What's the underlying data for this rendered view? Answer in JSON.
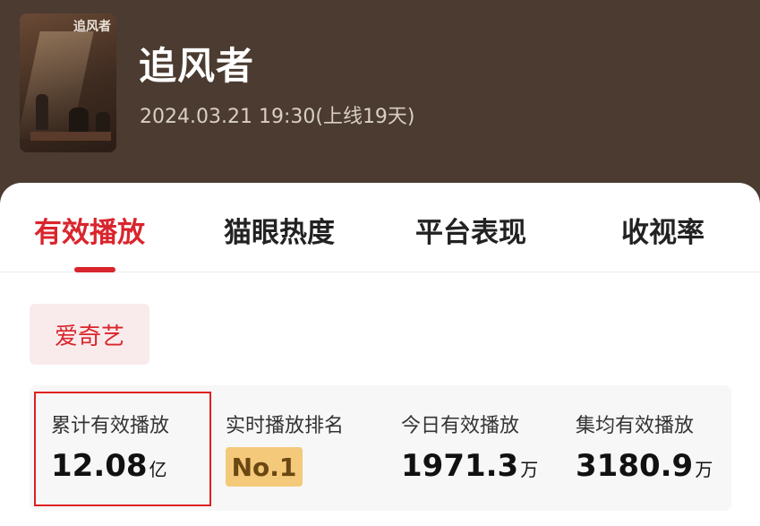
{
  "show": {
    "poster_title": "追风者",
    "title": "追风者",
    "subtitle": "2024.03.21 19:30(上线19天)"
  },
  "tabs": [
    {
      "label": "有效播放",
      "active": true
    },
    {
      "label": "猫眼热度",
      "active": false
    },
    {
      "label": "平台表现",
      "active": false
    },
    {
      "label": "收视率",
      "active": false
    }
  ],
  "platform": {
    "label": "爱奇艺"
  },
  "stats": {
    "total": {
      "label": "累计有效播放",
      "value": "12.08",
      "unit": "亿"
    },
    "rank": {
      "label": "实时播放排名",
      "value": "No.1"
    },
    "today": {
      "label": "今日有效播放",
      "value": "1971.3",
      "unit": "万"
    },
    "avg": {
      "label": "集均有效播放",
      "value": "3180.9",
      "unit": "万"
    }
  },
  "colors": {
    "header_bg": "#4b3b30",
    "accent": "#d9252d",
    "highlight_border": "#e02020",
    "rank_badge": "#f4c97a"
  }
}
